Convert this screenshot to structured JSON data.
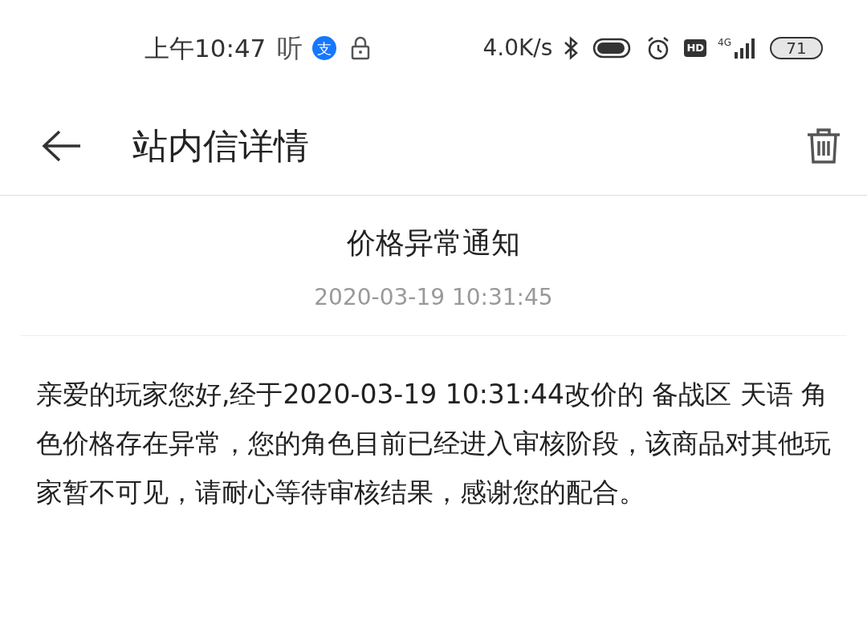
{
  "status_bar": {
    "time": "上午10:47",
    "app_glyph": "听",
    "alipay_glyph": "支",
    "net_speed": "4.0K/s",
    "hd": "HD",
    "network": "4G",
    "battery": "71"
  },
  "header": {
    "title": "站内信详情"
  },
  "message": {
    "title": "价格异常通知",
    "date": "2020-03-19 10:31:45",
    "body": "亲爱的玩家您好,经于2020-03-19 10:31:44改价的 备战区 天语 角色价格存在异常，您的角色目前已经进入审核阶段，该商品对其他玩家暂不可见，请耐心等待审核结果，感谢您的配合。"
  }
}
